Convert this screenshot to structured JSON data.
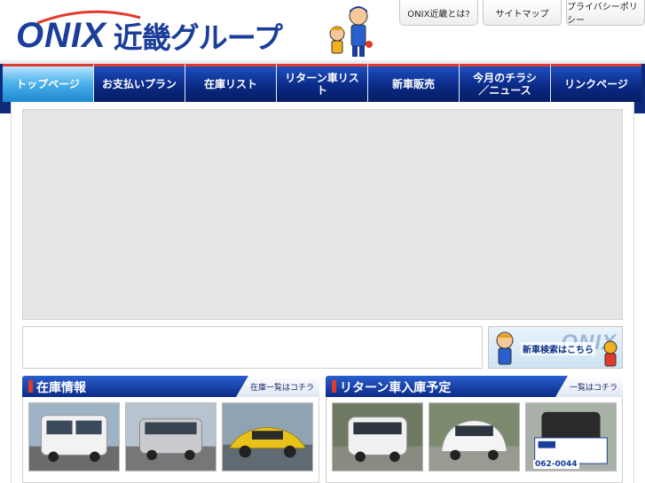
{
  "header": {
    "logo_brand": "ONIX",
    "logo_group": "近畿グループ",
    "top_links": [
      {
        "label": "ONIX近畿とは?"
      },
      {
        "label": "サイトマップ"
      },
      {
        "label": "プライバシーポリシー"
      }
    ]
  },
  "nav": {
    "items": [
      {
        "label": "トップページ"
      },
      {
        "label": "お支払いプラン"
      },
      {
        "label": "在庫リスト"
      },
      {
        "label": "リターン車リスト"
      },
      {
        "label": "新車販売"
      },
      {
        "label": "今月のチラシ\n／ニュース"
      },
      {
        "label": "リンクページ"
      }
    ]
  },
  "banner": {
    "brand": "ONIX",
    "text": "新車検索はこちら"
  },
  "stock_panel": {
    "title": "在庫情報",
    "more_link": "在庫一覧はコチラ",
    "cars": [
      {
        "name": "white-van",
        "color": "#f2f2f2"
      },
      {
        "name": "silver-wagon",
        "color": "#c9cbce"
      },
      {
        "name": "yellow-coupe",
        "color": "#e8c21a"
      }
    ]
  },
  "return_panel": {
    "title": "リターン車入庫予定",
    "more_link": "一覧はコチラ",
    "cars": [
      {
        "name": "white-kei-car",
        "color": "#f0f0f0"
      },
      {
        "name": "white-compact",
        "color": "#f4f4f4"
      },
      {
        "name": "black-kei-car",
        "color": "#2a2a2a"
      }
    ],
    "sign_phone": "062-0044"
  },
  "colors": {
    "brand_blue": "#1a3e9a",
    "nav_dark": "#0a2a85",
    "nav_active": "#4fb3ec",
    "accent_red": "#e23a2a"
  }
}
